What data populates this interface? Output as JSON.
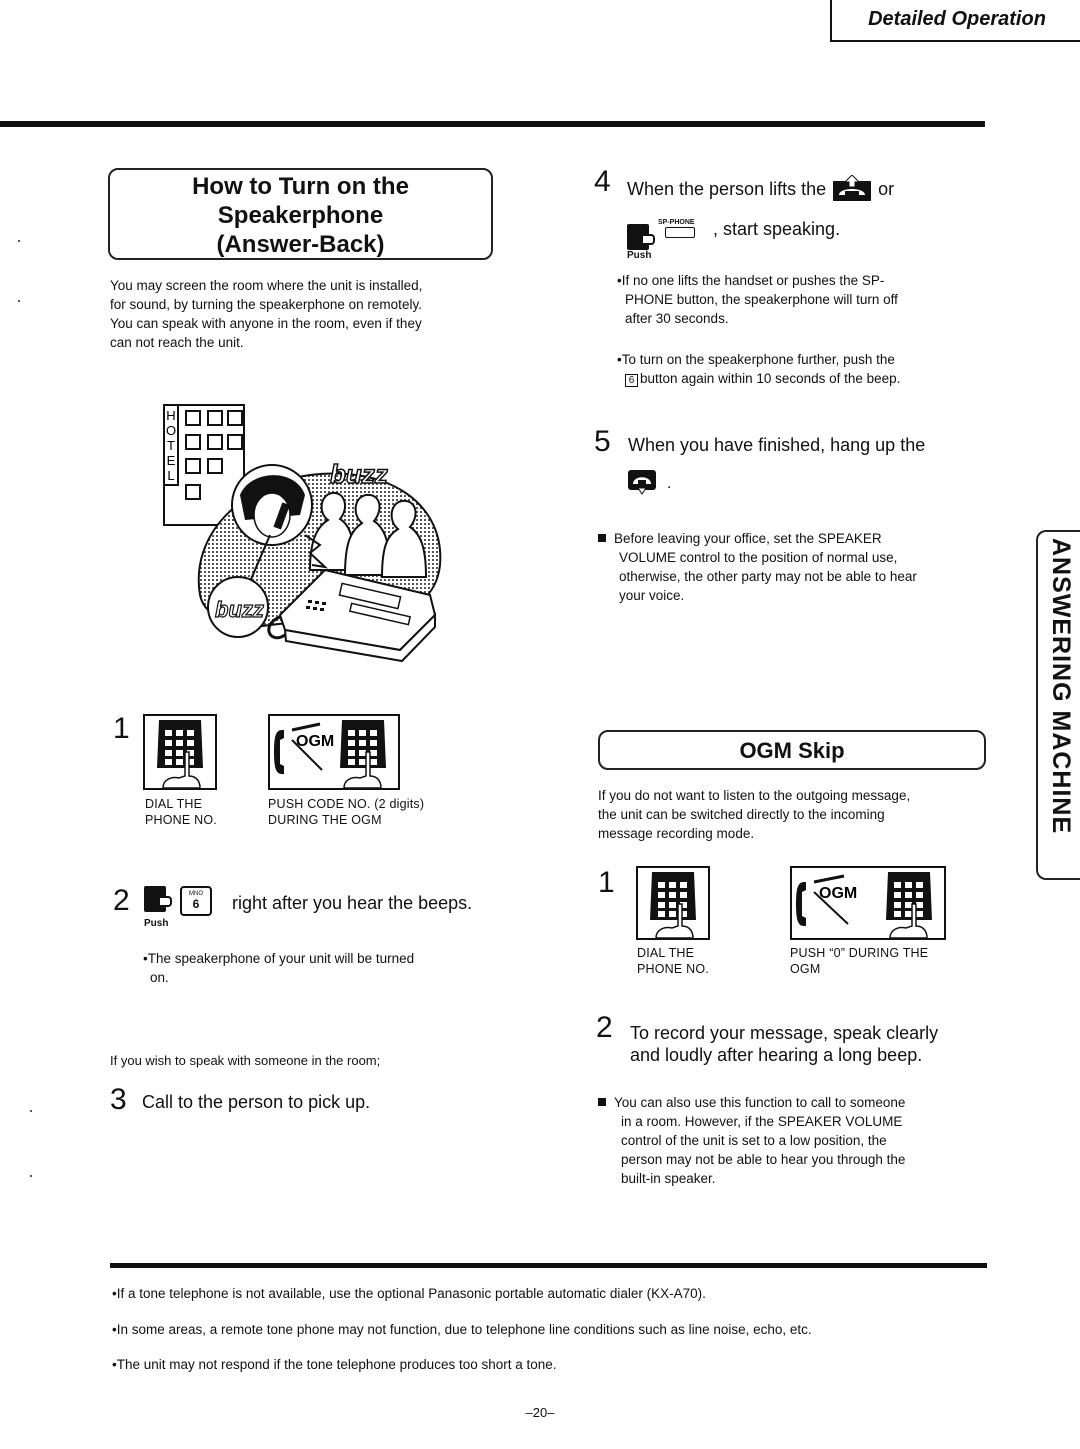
{
  "header": {
    "section_title": "Detailed Operation"
  },
  "side_tab": {
    "label": "ANSWERING MACHINE"
  },
  "left": {
    "title_lines": [
      "How to Turn on the",
      "Speakerphone",
      "(Answer-Back)"
    ],
    "intro_lines": [
      "You may screen the room where the unit is installed,",
      "for sound, by turning the speakerphone on remotely.",
      "You can speak with anyone in the room, even if they",
      "can not reach the unit."
    ],
    "illustration": {
      "hotel_letters": [
        "H",
        "O",
        "T",
        "E",
        "L"
      ],
      "buzz_text": "buzz"
    },
    "step1": {
      "number": "1",
      "caption_a": [
        "DIAL THE",
        "PHONE NO."
      ],
      "caption_b": [
        "PUSH CODE NO. (2 digits)",
        "DURING THE OGM"
      ],
      "ogm_label": "OGM"
    },
    "step2": {
      "number": "2",
      "push_label": "Push",
      "key_top": "MNO",
      "key_main": "6",
      "text": "right after you hear the beeps.",
      "bullet": [
        "•The speakerphone of your unit will be turned",
        "on."
      ]
    },
    "wish_text": "If you wish to speak with someone in the room;",
    "step3": {
      "number": "3",
      "text": "Call to the person to pick up."
    }
  },
  "right": {
    "step4": {
      "number": "4",
      "text_a": "When the person lifts the",
      "text_or": "or",
      "sp_phone_label": "SP-PHONE",
      "text_b": ", start speaking.",
      "push_label": "Push",
      "bullet1": [
        "•If no one lifts the handset or pushes the SP-",
        "PHONE button, the speakerphone will turn off",
        "after 30 seconds."
      ],
      "bullet2_a": "•To turn on the speakerphone further, push the",
      "bullet2_key": "6",
      "bullet2_b": "button again within 10 seconds of the beep."
    },
    "step5": {
      "number": "5",
      "text": "When you have finished, hang up the",
      "period": ".",
      "note": [
        "Before leaving your office, set the SPEAKER",
        "VOLUME control to the position of normal use,",
        "otherwise, the other party may not be able to hear",
        "your voice."
      ]
    },
    "ogm_skip": {
      "title": "OGM Skip",
      "intro": [
        "If you do not want to listen to the outgoing message,",
        "the unit can be switched directly to the incoming",
        "message recording mode."
      ],
      "step1": {
        "number": "1",
        "caption_a": [
          "DIAL THE",
          "PHONE NO."
        ],
        "caption_b": [
          "PUSH “0” DURING THE",
          "OGM"
        ],
        "ogm_label": "OGM"
      },
      "step2": {
        "number": "2",
        "text": [
          "To record your message, speak clearly",
          "and loudly after hearing a long beep."
        ]
      },
      "note": [
        "You can also use this function to call to someone",
        "in a room. However, if the SPEAKER VOLUME",
        "control of the unit is set to a low position, the",
        "person may not be able to hear you through the",
        "built-in speaker."
      ]
    }
  },
  "footnotes": [
    "•If a tone telephone is not available, use the optional Panasonic portable automatic dialer (KX-A70).",
    "•In some areas, a remote tone phone may not function, due to telephone line conditions such as line noise, echo, etc.",
    "•The unit may not respond if the tone telephone produces too short a tone."
  ],
  "page_number": "–20–"
}
